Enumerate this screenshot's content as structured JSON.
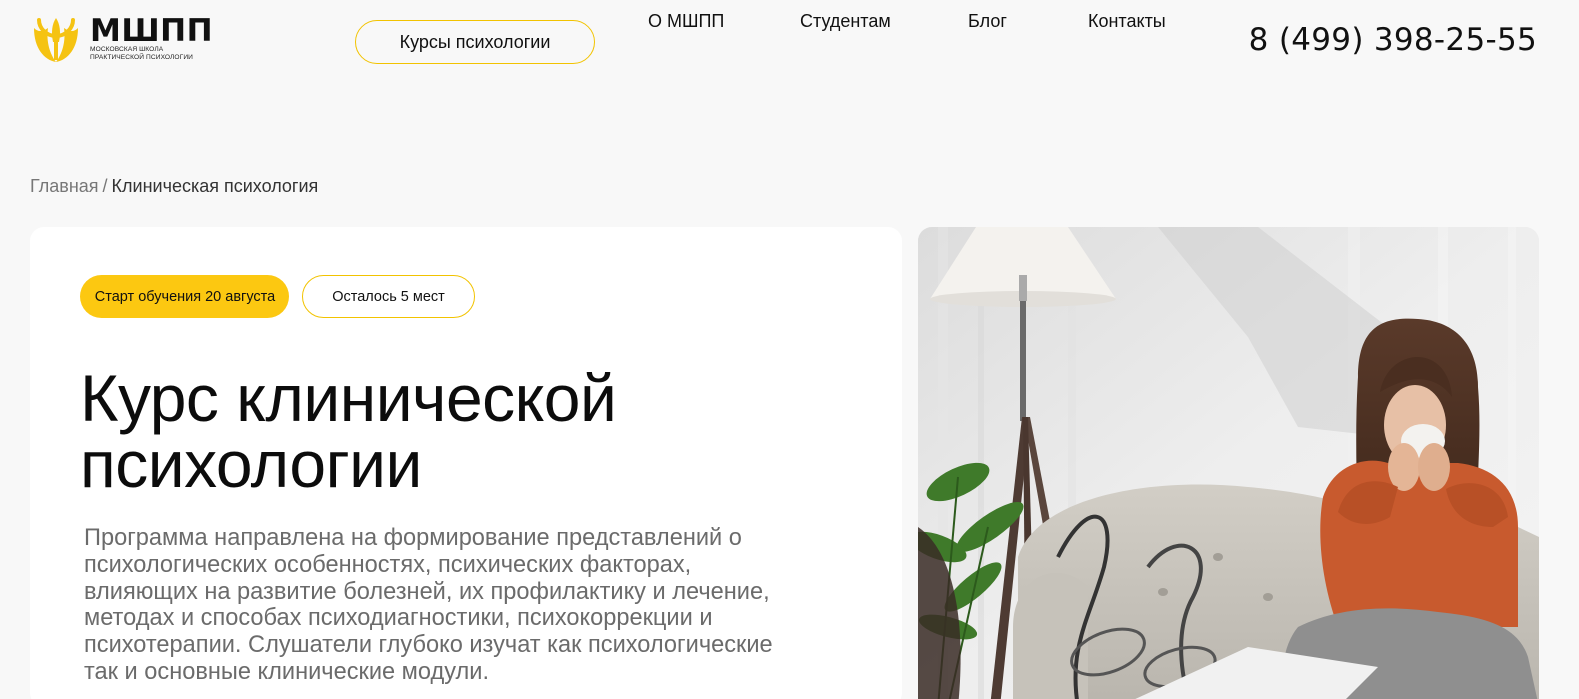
{
  "header": {
    "logo": {
      "title": "МШПП",
      "subtitle_line1": "Московская школа",
      "subtitle_line2": "практической психологии"
    },
    "nav": {
      "courses_button": "Курсы психологии",
      "about": "О МШПП",
      "students": "Студентам",
      "blog": "Блог",
      "contacts": "Контакты"
    },
    "phone": "8 (499) 398-25-55"
  },
  "breadcrumb": {
    "home": "Главная",
    "separator": "/",
    "current": "Клиническая психология"
  },
  "hero": {
    "badges": {
      "start": "Старт обучения 20 августа",
      "seats": "Осталось 5 мест"
    },
    "title_line1": "Курс клинической",
    "title_line2": "психологии",
    "description_lines": [
      "Программа направлена на формирование представлений о",
      "психологических особенностях, психических факторах,",
      "влияющих на развитие болезней, их профилактику и лечение,",
      "методах и способах психодиагностики, психокоррекции и",
      "психотерапии. Слушатели глубоко изучат как психологические",
      "так и основные клинические модули."
    ]
  },
  "colors": {
    "accent": "#fcc811",
    "accent_border": "#f2c300",
    "page_background": "#f8f8f8",
    "card_background": "#ffffff",
    "text_primary": "#111111",
    "text_secondary": "#6b6b6b"
  },
  "icons": {
    "logo": "yellow-psi-leaf-logo-icon"
  }
}
